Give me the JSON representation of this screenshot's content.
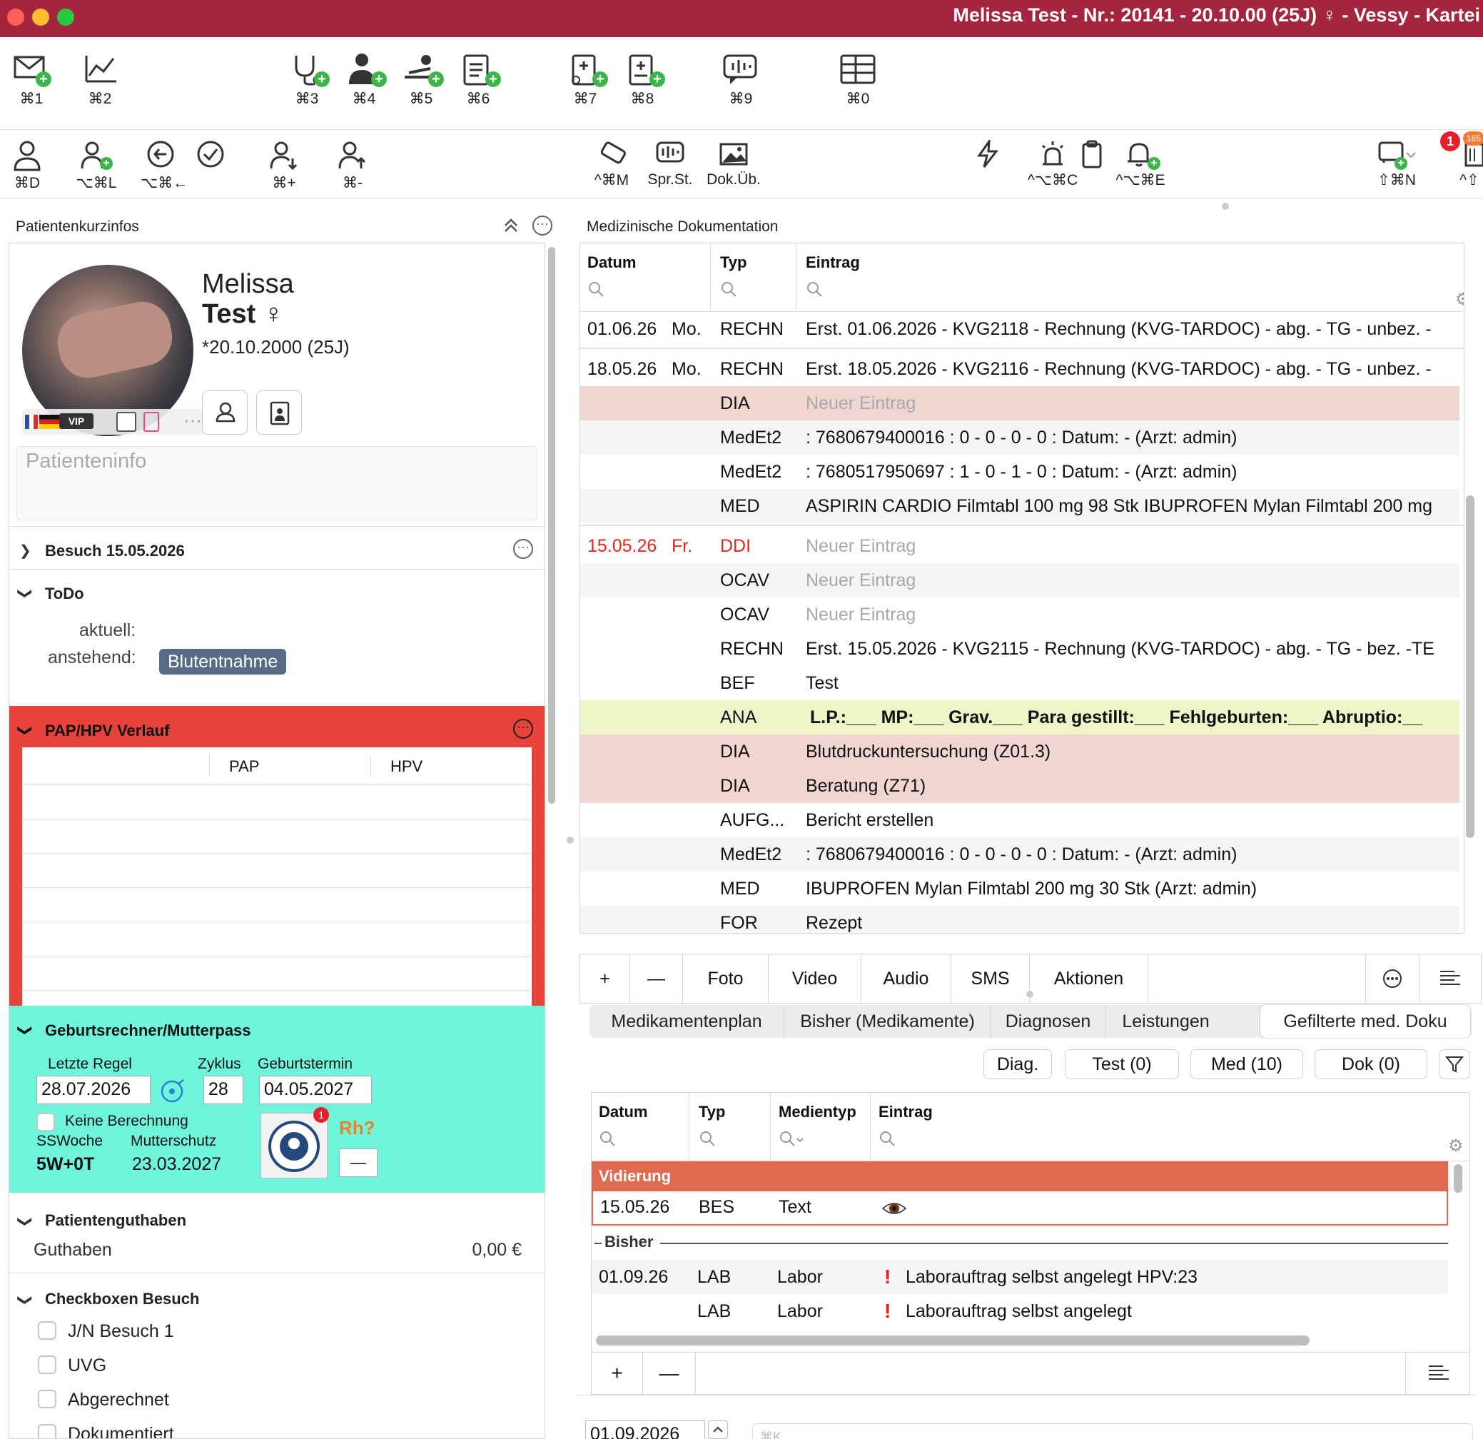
{
  "window": {
    "title": "Melissa Test - Nr.: 20141 - 20.10.00 (25J) ♀ - Vessy - Kartei"
  },
  "toolbar1": [
    {
      "name": "mail-plus-icon",
      "label": "⌘1"
    },
    {
      "name": "chart-hand-icon",
      "label": "⌘2"
    },
    {
      "name": "stethoscope-plus-icon",
      "label": "⌘3"
    },
    {
      "name": "doctor-plus-icon",
      "label": "⌘4"
    },
    {
      "name": "patient-bed-plus-icon",
      "label": "⌘5"
    },
    {
      "name": "clipboard-plus-icon",
      "label": "⌘6"
    },
    {
      "name": "clipboard-medical-plus-icon",
      "label": "⌘7"
    },
    {
      "name": "clipboard-cross-plus-icon",
      "label": "⌘8"
    },
    {
      "name": "speech-mic-icon",
      "label": "⌘9"
    },
    {
      "name": "table-icon",
      "label": "⌘0"
    }
  ],
  "toolbar2": [
    {
      "name": "person-icon",
      "label": "⌘D"
    },
    {
      "name": "person-list-plus-icon",
      "label": "⌥⌘L"
    },
    {
      "name": "back-circle-icon",
      "label": "⌥⌘←"
    },
    {
      "name": "check-circle-icon",
      "label": ""
    },
    {
      "name": "person-down-icon",
      "label": "⌘+"
    },
    {
      "name": "person-up-icon",
      "label": "⌘-"
    },
    {
      "name": "eraser-icon",
      "label": "^⌘M"
    },
    {
      "name": "speech-wave-icon",
      "label": "Spr.St."
    },
    {
      "name": "image-icon",
      "label": "Dok.Üb."
    },
    {
      "name": "lightning-icon",
      "label": ""
    },
    {
      "name": "alarm-light-icon",
      "label": "^⌥⌘C"
    },
    {
      "name": "clipboard-icon",
      "label": ""
    },
    {
      "name": "bell-plus-icon",
      "label": "^⌥⌘E"
    },
    {
      "name": "chat-plus-icon",
      "label": "⇧⌘N"
    },
    {
      "name": "inbox-icon",
      "label": "^⇧"
    }
  ],
  "badges": {
    "notifications": "1",
    "inbox": "165"
  },
  "left": {
    "panel_title": "Patientenkurzinfos",
    "patient": {
      "first": "Melissa",
      "last": "Test ♀",
      "dob": "*20.10.2000 (25J)"
    },
    "patientinfo_placeholder": "Patienteninfo",
    "visit": "Besuch 15.05.2026",
    "todo": {
      "title": "ToDo",
      "current_label": "aktuell:",
      "pending_label": "anstehend:",
      "pending_tag": "Blutentnahme"
    },
    "pap": {
      "title": "PAP/HPV Verlauf",
      "col_pap": "PAP",
      "col_hpv": "HPV"
    },
    "birth": {
      "title": "Geburtsrechner/Mutterpass",
      "last_period_label": "Letzte Regel",
      "last_period": "28.07.2026",
      "cycle_label": "Zyklus",
      "cycle": "28",
      "due_label": "Geburtstermin",
      "due": "04.05.2027",
      "no_calc_label": "Keine Berechnung",
      "ssw_label": "SSWoche",
      "ssw": "5W+0T",
      "maternity_label": "Mutterschutz",
      "maternity": "23.03.2027",
      "rh": "Rh?",
      "minus": "—",
      "mutterpass_badge": "1"
    },
    "credit": {
      "title": "Patientenguthaben",
      "label": "Guthaben",
      "value": "0,00 €"
    },
    "checks": {
      "title": "Checkboxen Besuch",
      "items": [
        "J/N Besuch 1",
        "UVG",
        "Abgerechnet",
        "Dokumentiert"
      ]
    }
  },
  "right": {
    "panel_title": "Medizinische Dokumentation",
    "headers": {
      "date": "Datum",
      "type": "Typ",
      "entry": "Eintrag"
    },
    "rows": [
      {
        "date": "01.06.26",
        "day": "Mo.",
        "type": "RECHN",
        "entry": "Erst. 01.06.2026 - KVG2118 - Rechnung (KVG-TARDOC) - abg. - TG - unbez. -",
        "style": "normal",
        "bg": "#ffffff"
      },
      {
        "date": "18.05.26",
        "day": "Mo.",
        "type": "RECHN",
        "entry": "Erst. 18.05.2026 - KVG2116 - Rechnung (KVG-TARDOC) - abg. - TG - unbez. -",
        "style": "normal",
        "bg": "#ffffff"
      },
      {
        "date": "",
        "day": "",
        "type": "DIA",
        "entry": "Neuer Eintrag",
        "style": "muted",
        "bg": "#f0d5d0"
      },
      {
        "date": "",
        "day": "",
        "type": "MedEt2",
        "entry": ": 7680679400016  : 0 - 0 - 0 - 0  :   Datum: - (Arzt: admin)",
        "style": "normal",
        "bg": "#f5f5f5"
      },
      {
        "date": "",
        "day": "",
        "type": "MedEt2",
        "entry": ": 7680517950697  : 1 - 0 - 1 - 0  :   Datum: - (Arzt: admin)",
        "style": "normal",
        "bg": "#ffffff"
      },
      {
        "date": "",
        "day": "",
        "type": "MED",
        "entry": "ASPIRIN CARDIO Filmtabl 100 mg 98 Stk  IBUPROFEN Mylan Filmtabl 200 mg",
        "style": "normal",
        "bg": "#f5f5f5"
      },
      {
        "date": "15.05.26",
        "day": "Fr.",
        "type": "DDI",
        "entry": "Neuer Eintrag",
        "style": "red",
        "bg": "#ffffff"
      },
      {
        "date": "",
        "day": "",
        "type": "OCAV",
        "entry": "Neuer Eintrag",
        "style": "muted",
        "bg": "#f5f5f5"
      },
      {
        "date": "",
        "day": "",
        "type": "OCAV",
        "entry": "Neuer Eintrag",
        "style": "muted",
        "bg": "#ffffff"
      },
      {
        "date": "",
        "day": "",
        "type": "RECHN",
        "entry": "Erst. 15.05.2026 - KVG2115 - Rechnung (KVG-TARDOC) - abg. - TG - bez. -TE",
        "style": "normal",
        "bg": "#ffffff"
      },
      {
        "date": "",
        "day": "",
        "type": "BEF",
        "entry": "Test",
        "style": "normal",
        "bg": "#ffffff"
      },
      {
        "date": "",
        "day": "",
        "type": "ANA",
        "entry": "L.P.:___   MP:___  Grav.___   Para gestillt:___   Fehlgeburten:___  Abruptio:__",
        "style": "bold",
        "bg": "#f0f5c8"
      },
      {
        "date": "",
        "day": "",
        "type": "DIA",
        "entry": "Blutdruckuntersuchung (Z01.3)",
        "style": "normal",
        "bg": "#f0d5d0"
      },
      {
        "date": "",
        "day": "",
        "type": "DIA",
        "entry": "Beratung (Z71)",
        "style": "normal",
        "bg": "#f0d5d0"
      },
      {
        "date": "",
        "day": "",
        "type": "AUFG...",
        "entry": "Bericht erstellen",
        "style": "normal",
        "bg": "#ffffff"
      },
      {
        "date": "",
        "day": "",
        "type": "MedEt2",
        "entry": ": 7680679400016  : 0 - 0 - 0 - 0  :   Datum: - (Arzt: admin)",
        "style": "normal",
        "bg": "#f5f5f5"
      },
      {
        "date": "",
        "day": "",
        "type": "MED",
        "entry": "IBUPROFEN Mylan Filmtabl 200 mg 30 Stk (Arzt: admin)",
        "style": "normal",
        "bg": "#ffffff"
      },
      {
        "date": "",
        "day": "",
        "type": "FOR",
        "entry": "Rezept",
        "style": "normal",
        "bg": "#f5f5f5"
      }
    ],
    "bottom_bar": {
      "add": "+",
      "remove": "—",
      "photo": "Foto",
      "video": "Video",
      "audio": "Audio",
      "sms": "SMS",
      "actions": "Aktionen"
    },
    "tabs": [
      "Medikamentenplan",
      "Bisher (Medikamente)",
      "Diagnosen",
      "Leistungen",
      "Gefilterte med. Doku"
    ],
    "filters": {
      "diag": "Diag.",
      "test": "Test (0)",
      "med": "Med (10)",
      "dok": "Dok (0)"
    },
    "media": {
      "headers": {
        "date": "Datum",
        "type": "Typ",
        "mediatype": "Medientyp",
        "entry": "Eintrag"
      },
      "group_vid": "Vidierung",
      "vid_row": {
        "date": "15.05.26",
        "type": "BES",
        "mediatype": "Text"
      },
      "group_prev": "Bisher",
      "rows": [
        {
          "date": "01.09.26",
          "type": "LAB",
          "mediatype": "Labor",
          "entry": "Laborauftrag selbst angelegt HPV:23"
        },
        {
          "date": "",
          "type": "LAB",
          "mediatype": "Labor",
          "entry": "Laborauftrag selbst angelegt"
        }
      ],
      "add": "+",
      "remove": "—"
    },
    "bottom_date": "01.09.2026",
    "bottom_placeholder": "⌘K"
  },
  "colors": {
    "titlebar": "#a3253e",
    "pap_border": "#e8433a",
    "birth_bg": "#6ef5dc",
    "ddi_red": "#e0291e",
    "vid_header": "#e06a50",
    "tag": "#586a85"
  }
}
